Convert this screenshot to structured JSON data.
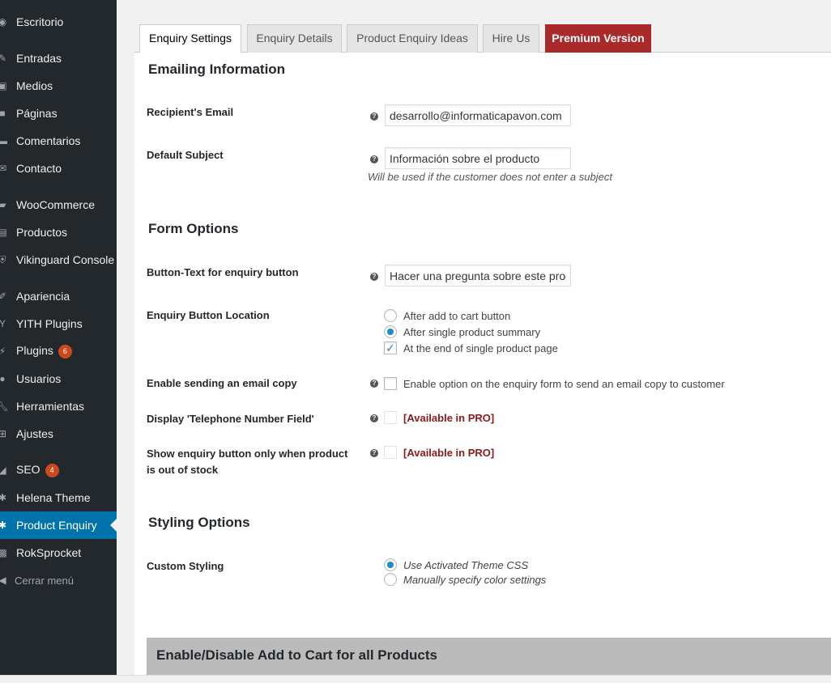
{
  "sidebar": {
    "items": [
      {
        "label": "Escritorio",
        "icon": "dashboard-icon"
      },
      {
        "label": "Entradas",
        "icon": "pin-icon"
      },
      {
        "label": "Medios",
        "icon": "media-icon"
      },
      {
        "label": "Páginas",
        "icon": "page-icon"
      },
      {
        "label": "Comentarios",
        "icon": "comment-icon"
      },
      {
        "label": "Contacto",
        "icon": "mail-icon"
      },
      {
        "label": "WooCommerce",
        "icon": "woo-icon"
      },
      {
        "label": "Productos",
        "icon": "archive-icon"
      },
      {
        "label": "Vikinguard Console",
        "icon": "shield-icon"
      },
      {
        "label": "Apariencia",
        "icon": "brush-icon"
      },
      {
        "label": "YITH Plugins",
        "icon": "yith-icon"
      },
      {
        "label": "Plugins",
        "icon": "plugin-icon",
        "badge": "6"
      },
      {
        "label": "Usuarios",
        "icon": "user-icon"
      },
      {
        "label": "Herramientas",
        "icon": "wrench-icon"
      },
      {
        "label": "Ajustes",
        "icon": "settings-icon"
      },
      {
        "label": "SEO",
        "icon": "seo-icon",
        "badge": "4"
      },
      {
        "label": "Helena Theme",
        "icon": "gear-icon"
      },
      {
        "label": "Product Enquiry",
        "icon": "gear-icon"
      },
      {
        "label": "RokSprocket",
        "icon": "rok-icon"
      }
    ],
    "collapse_label": "Cerrar menú"
  },
  "tabs": [
    {
      "label": "Enquiry Settings"
    },
    {
      "label": "Enquiry Details"
    },
    {
      "label": "Product Enquiry Ideas"
    },
    {
      "label": "Hire Us"
    },
    {
      "label": "Premium Version"
    }
  ],
  "emailing": {
    "title": "Emailing Information",
    "recipient_label": "Recipient's Email",
    "recipient_value": "desarrollo@informaticapavon.com",
    "subject_label": "Default Subject",
    "subject_value": "Información sobre el producto",
    "subject_desc": "Will be used if the customer does not enter a subject"
  },
  "form_options": {
    "title": "Form Options",
    "button_text_label": "Button-Text for enquiry button",
    "button_text_value": "Hacer una pregunta sobre este producto",
    "location_label": "Enquiry Button Location",
    "location_options": [
      {
        "label": "After add to cart button",
        "checked": false
      },
      {
        "label": "After single product summary",
        "checked": true
      },
      {
        "label": "At the end of single product page",
        "checked": true
      }
    ],
    "email_copy_label": "Enable sending an email copy",
    "email_copy_option": "Enable option on the enquiry form to send an email copy to customer",
    "telephone_label": "Display 'Telephone Number Field'",
    "telephone_value": "[Available in PRO]",
    "out_of_stock_label": "Show enquiry button only when product is out of stock",
    "out_of_stock_value": "[Available in PRO]"
  },
  "styling": {
    "title": "Styling Options",
    "custom_label": "Custom Styling",
    "options": [
      {
        "label": "Use Activated Theme CSS",
        "checked": true
      },
      {
        "label": "Manually specify color settings",
        "checked": false
      }
    ]
  },
  "add_to_cart_section": {
    "title": "Enable/Disable Add to Cart for all Products"
  },
  "colors": {
    "sidebar_bg": "#23282d",
    "current_item": "#0073aa",
    "premium_tab": "#a82a2a",
    "badge": "#ca4a1f",
    "pro_text": "#8b1a1a"
  }
}
